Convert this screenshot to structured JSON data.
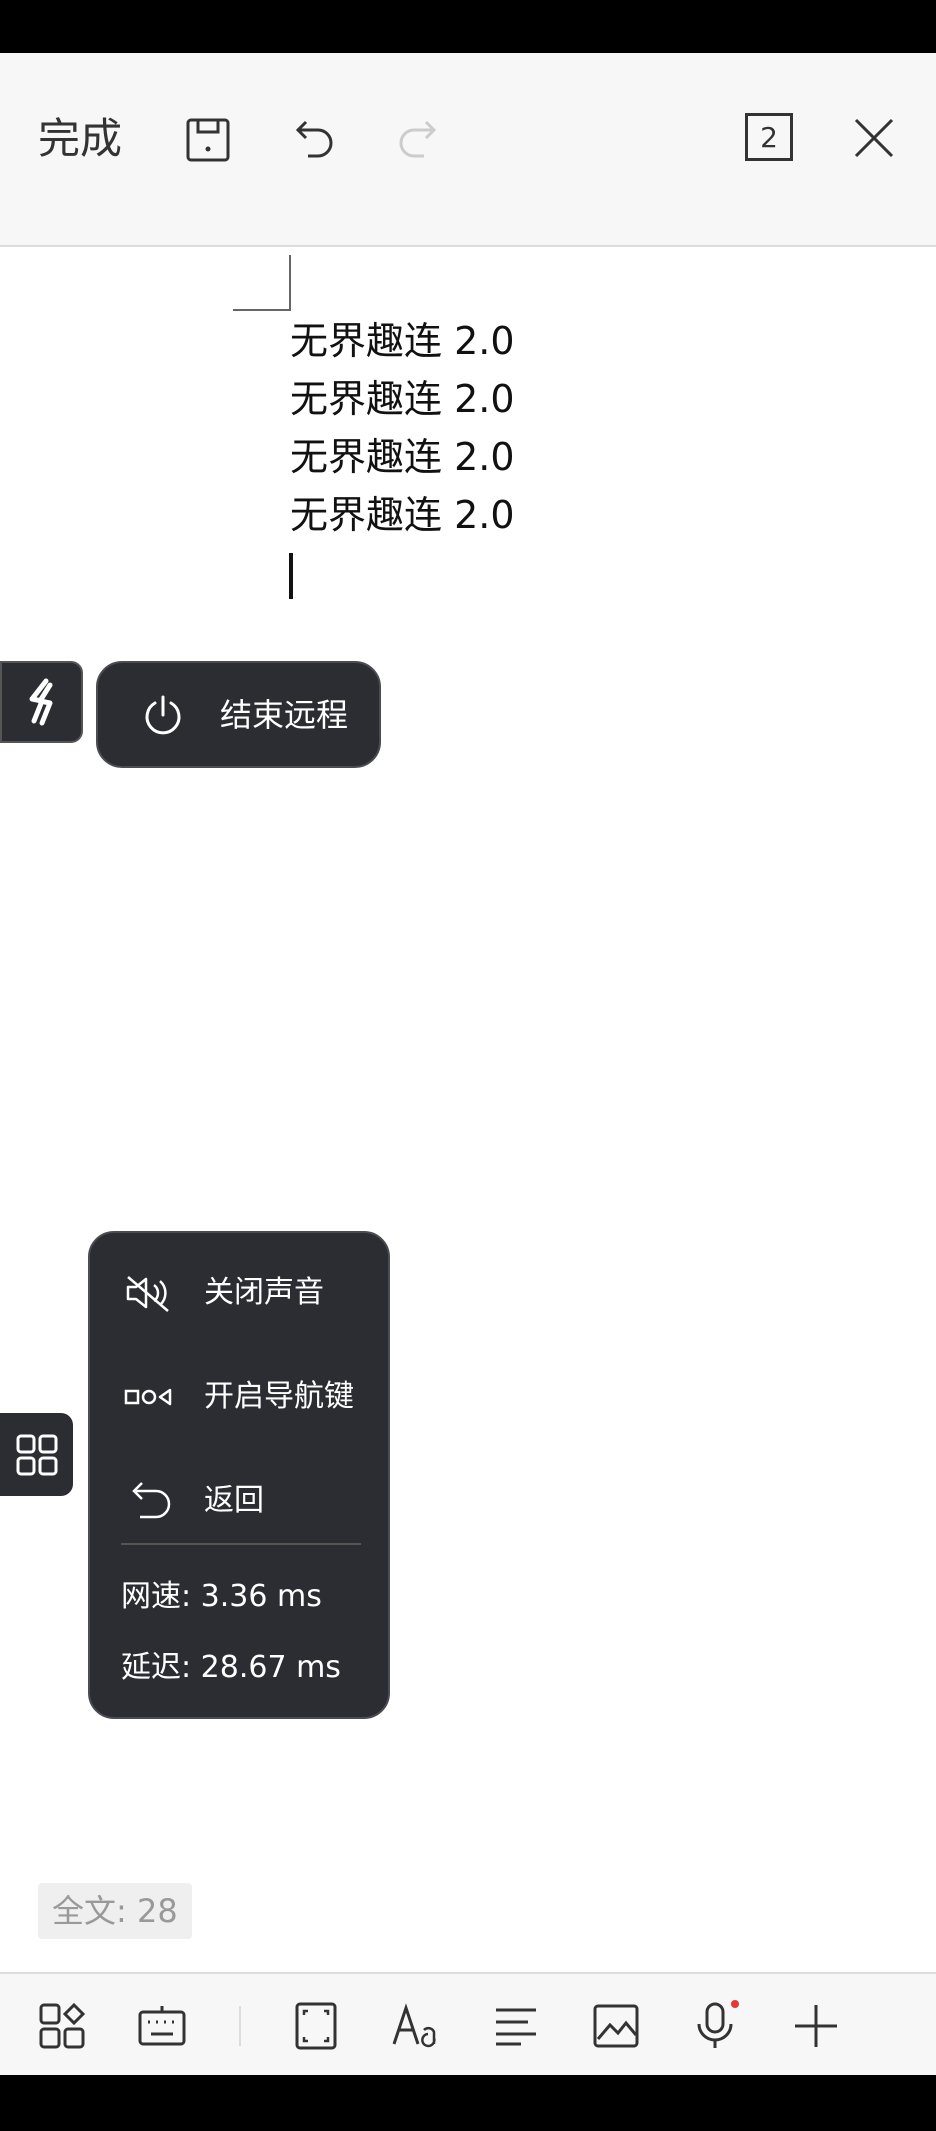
{
  "toolbar": {
    "done_label": "完成",
    "page_count": "2"
  },
  "document": {
    "lines": [
      "无界趣连 2.0",
      "无界趣连 2.0",
      "无界趣连 2.0",
      "无界趣连 2.0"
    ]
  },
  "remote": {
    "end_label": "结束远程"
  },
  "float_menu": {
    "items": [
      {
        "label": "关闭声音",
        "icon": "speaker-muted-icon"
      },
      {
        "label": "开启导航键",
        "icon": "nav-keys-icon"
      },
      {
        "label": "返回",
        "icon": "back-arrow-icon"
      }
    ],
    "speed": "网速: 3.36 ms",
    "latency": "延迟: 28.67 ms"
  },
  "status": {
    "word_count": "全文: 28"
  },
  "colors": {
    "panel_bg": "#2b2d33",
    "toolbar_bg": "#f7f7f7",
    "mic_dot": "#e53935"
  }
}
